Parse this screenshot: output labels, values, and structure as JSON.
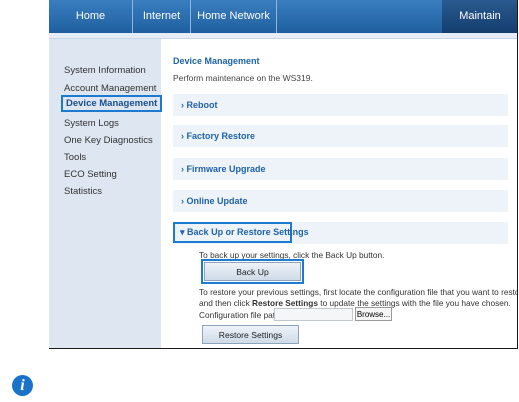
{
  "nav": {
    "tabs": [
      "Home",
      "Internet",
      "Home Network",
      "Maintain"
    ],
    "active": "Maintain"
  },
  "sidebar": {
    "items": [
      "System Information",
      "Account Management",
      "Device Management",
      "System Logs",
      "One Key Diagnostics",
      "Tools",
      "ECO Setting",
      "Statistics"
    ],
    "active": "Device Management"
  },
  "main": {
    "title": "Device Management",
    "description": "Perform maintenance on the WS319.",
    "sections": [
      "Reboot",
      "Factory Restore",
      "Firmware Upgrade",
      "Online Update",
      "Back Up or Restore Settings"
    ],
    "expanded": "Back Up or Restore Settings",
    "backup_text": "To back up your settings, click the Back Up button.",
    "backup_button": "Back Up",
    "restore_line1": "To restore your previous settings, first locate the configuration file that you want to restore,",
    "restore_line2_pre": "and then click ",
    "restore_line2_bold": "Restore Settings",
    "restore_line2_post": " to update the settings with the file you have chosen.",
    "config_label": "Configuration file path:",
    "browse_button": "Browse...",
    "restore_button": "Restore Settings"
  },
  "icons": {
    "chevron_right": "›",
    "chevron_down": "▾",
    "info": "i"
  },
  "colors": {
    "accent": "#1c7ad0",
    "nav_blue": "#2b6fb2",
    "sidebar_bg": "#dde6f1"
  }
}
